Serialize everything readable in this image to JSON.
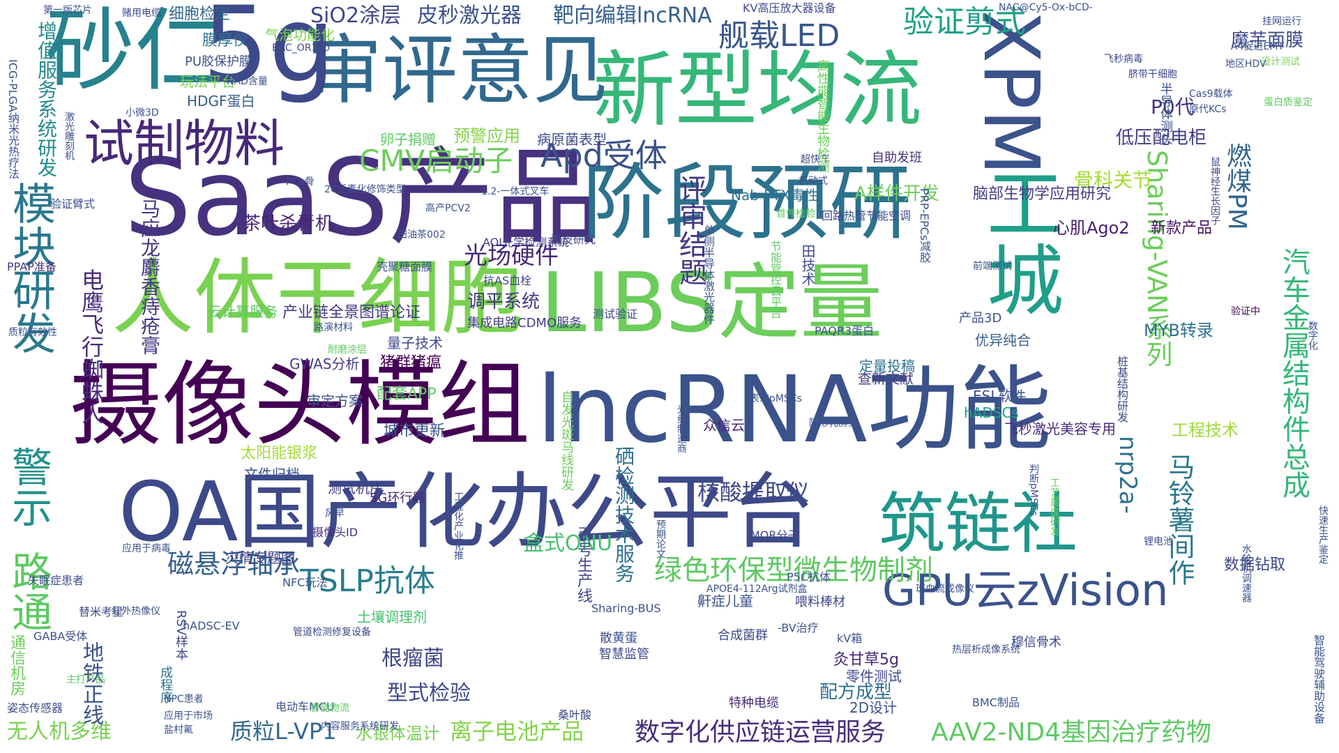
{
  "words": [
    {
      "text": "SaaS产品",
      "color": "#46327e"
    },
    {
      "text": "摄像头模组",
      "color": "#440154"
    },
    {
      "text": "lncRNA功能",
      "color": "#3b528b"
    },
    {
      "text": "OA国产化办公平台",
      "color": "#3e4989"
    },
    {
      "text": "人体干细胞",
      "color": "#7ad151"
    },
    {
      "text": "阶段预研",
      "color": "#2c728e"
    },
    {
      "text": "LIBS定量",
      "color": "#6ccd5a"
    },
    {
      "text": "新型均流",
      "color": "#35b779"
    },
    {
      "text": "审评意见",
      "color": "#31688e"
    },
    {
      "text": "砂仁",
      "color": "#26828e"
    },
    {
      "text": "5g",
      "color": "#3e4989"
    },
    {
      "text": "工城",
      "color": "#1f9e89"
    },
    {
      "text": "XPM",
      "color": "#3b528b"
    },
    {
      "text": "筑链社",
      "color": "#1f968b"
    },
    {
      "text": "试制物料",
      "color": "#482878"
    },
    {
      "text": "模块研发",
      "color": "#2a788e"
    },
    {
      "text": "路通",
      "color": "#5ec962"
    },
    {
      "text": "警示",
      "color": "#21918c"
    },
    {
      "text": "GPU云zVision",
      "color": "#3b528b"
    },
    {
      "text": "绿色环保型微生物制剂",
      "color": "#5ec962"
    },
    {
      "text": "CMV启动子",
      "color": "#6ccd5a"
    },
    {
      "text": "Apd受体",
      "color": "#3b528b"
    },
    {
      "text": "汽车金属结构件总成",
      "color": "#35b779"
    },
    {
      "text": "数字化供应链运营服务",
      "color": "#472d7b"
    },
    {
      "text": "AAV2-ND4基因治疗药物",
      "color": "#5ec962"
    },
    {
      "text": "磁悬浮轴承",
      "color": "#355f8d"
    },
    {
      "text": "TSLP抗体",
      "color": "#287c8e"
    },
    {
      "text": "验证剪式",
      "color": "#1fa188"
    },
    {
      "text": "舰载LED",
      "color": "#39568c"
    },
    {
      "text": "光场硬件",
      "color": "#482878"
    },
    {
      "text": "电鹰飞行蜘蛛人",
      "color": "#472d7b"
    },
    {
      "text": "评审结题",
      "color": "#443983"
    },
    {
      "text": "离子电池产品",
      "color": "#84d44b"
    },
    {
      "text": "马铃薯间作",
      "color": "#2a788e"
    },
    {
      "text": "Sharing-VAN系列",
      "color": "#6ccd5a"
    },
    {
      "text": "nrp2a-",
      "color": "#2c728e"
    },
    {
      "text": "核酸提取仪",
      "color": "#3e4989"
    },
    {
      "text": "质粒L-VP1",
      "color": "#31688e"
    },
    {
      "text": "无人机多维",
      "color": "#7ad151"
    },
    {
      "text": "骨科关节",
      "color": "#a5db36"
    },
    {
      "text": "燃煤PM",
      "color": "#32658e"
    },
    {
      "text": "增值服务系统研发",
      "color": "#23898e"
    },
    {
      "text": "SiO2涂层",
      "color": "#404688"
    },
    {
      "text": "皮秒激光器",
      "color": "#3b528b"
    },
    {
      "text": "靶向编辑lncRNA",
      "color": "#355f8d"
    },
    {
      "text": "茶叶杀青机",
      "color": "#482475"
    },
    {
      "text": "A样件开发",
      "color": "#6ccd5a"
    },
    {
      "text": "脑部生物学应用研究",
      "color": "#433e85"
    },
    {
      "text": "马应龙麝香痔疮膏",
      "color": "#453781"
    },
    {
      "text": "地铁正线",
      "color": "#3b528b"
    },
    {
      "text": "工程技术",
      "color": "#a0da39"
    },
    {
      "text": "水银体温计",
      "color": "#7ad151"
    },
    {
      "text": "根瘤菌",
      "color": "#404688"
    },
    {
      "text": "型式检验",
      "color": "#3e4989"
    },
    {
      "text": "硒检测技术服务",
      "color": "#2e6f8e"
    },
    {
      "text": "盒式ONU",
      "color": "#46c06f"
    },
    {
      "text": "调平系统",
      "color": "#443a83"
    },
    {
      "text": "产业链全景图谱论证",
      "color": "#443983"
    },
    {
      "text": "心肌Ago2",
      "color": "#481f70"
    },
    {
      "text": "新款产品",
      "color": "#481467"
    },
    {
      "text": "低压配电柜",
      "color": "#433e85"
    },
    {
      "text": "魔芋面膜",
      "color": "#3e4989"
    },
    {
      "text": "P0代",
      "color": "#46327e"
    },
    {
      "text": "MYB转录",
      "color": "#2c728e"
    },
    {
      "text": "飞秒激光美容专用",
      "color": "#472d7b"
    },
    {
      "text": "配方成型",
      "color": "#2e6f8e"
    },
    {
      "text": "数据钻取",
      "color": "#3e4989"
    },
    {
      "text": "卵子捐赠",
      "color": "#5ec962"
    },
    {
      "text": "预警应用",
      "color": "#84d44b"
    },
    {
      "text": "病原菌表型",
      "color": "#3e4989"
    },
    {
      "text": "细胞检定",
      "color": "#31688e"
    },
    {
      "text": "膜厚仪",
      "color": "#2c728e"
    },
    {
      "text": "气泡功能化",
      "color": "#7ad151"
    },
    {
      "text": "PU胶保护膜",
      "color": "#3b528b"
    },
    {
      "text": "玩法平台",
      "color": "#7ad151"
    },
    {
      "text": "HDGF蛋白",
      "color": "#355f8d"
    },
    {
      "text": "太阳能银浆",
      "color": "#a5db36"
    },
    {
      "text": "配套APP",
      "color": "#5ec962"
    },
    {
      "text": "猪群猪瘟",
      "color": "#440154"
    },
    {
      "text": "量子技术",
      "color": "#3e4989"
    },
    {
      "text": "审定方案",
      "color": "#3b528b"
    },
    {
      "text": "GWAS分析",
      "color": "#433e85"
    },
    {
      "text": "城市更新",
      "color": "#3b528b"
    },
    {
      "text": "文件归档",
      "color": "#3b528b"
    },
    {
      "text": "测试机房",
      "color": "#433e85"
    },
    {
      "text": "灾情专题图",
      "color": "#414487"
    },
    {
      "text": "云计算服务",
      "color": "#5ec962"
    },
    {
      "text": "集成电路CDMO服务",
      "color": "#433e85"
    },
    {
      "text": "优异纯合",
      "color": "#355f8d"
    },
    {
      "text": "ESL软件",
      "color": "#3b528b"
    },
    {
      "text": "hADSCs",
      "color": "#1f9e89"
    },
    {
      "text": "查新文献",
      "color": "#433e85"
    },
    {
      "text": "定量投稿",
      "color": "#2c728e"
    },
    {
      "text": "自助发班",
      "color": "#46327e"
    },
    {
      "text": "Nab-PTX毒性",
      "color": "#2e6f8e"
    },
    {
      "text": "田技术",
      "color": "#3e4989"
    },
    {
      "text": "引号生产线",
      "color": "#3e4989"
    },
    {
      "text": "众信云",
      "color": "#482878"
    },
    {
      "text": "通信机房",
      "color": "#6ccd5a"
    },
    {
      "text": "零件测试",
      "color": "#3e4989"
    },
    {
      "text": "2D设计",
      "color": "#3b528b"
    },
    {
      "text": "灸甘草5g",
      "color": "#482878"
    },
    {
      "text": "鼾症儿童",
      "color": "#3b528b"
    },
    {
      "text": "智慧监管",
      "color": "#3e4989"
    },
    {
      "text": "合成菌群",
      "color": "#3e4989"
    },
    {
      "text": "特种电缆",
      "color": "#482878"
    },
    {
      "text": "散黄蛋",
      "color": "#3b528b"
    },
    {
      "text": "喂料棒材",
      "color": "#3e4989"
    },
    {
      "text": "MOR分子",
      "color": "#3e4989"
    },
    {
      "text": "P5C抗体",
      "color": "#3b528b"
    },
    {
      "text": "5G环行器",
      "color": "#482878"
    },
    {
      "text": "成程序",
      "color": "#2c728e"
    },
    {
      "text": "RSV样本",
      "color": "#3e4989"
    },
    {
      "text": "GABA受体",
      "color": "#3b528b"
    },
    {
      "text": "姿态传感器",
      "color": "#3b528b"
    },
    {
      "text": "失眠症患者",
      "color": "#3b528b"
    },
    {
      "text": "替米考星",
      "color": "#3e4989"
    },
    {
      "text": "验证臂式",
      "color": "#3b528b"
    },
    {
      "text": "PPAP准备",
      "color": "#46327e"
    },
    {
      "text": "电动车MCU",
      "color": "#3b528b"
    },
    {
      "text": "摄像头ID",
      "color": "#46327e"
    },
    {
      "text": "土壤调理剂",
      "color": "#46c06f"
    },
    {
      "text": "AOI光学检测系统",
      "color": "#433e85"
    },
    {
      "text": "配皮研究",
      "color": "#3e4989"
    },
    {
      "text": "抗AS血栓",
      "color": "#3e4989"
    },
    {
      "text": "壳聚糖面膜",
      "color": "#3b528b"
    },
    {
      "text": "产品3D",
      "color": "#3b528b"
    },
    {
      "text": "PAQR3蛋白",
      "color": "#3b528b"
    },
    {
      "text": "测试验证",
      "color": "#3e4989"
    },
    {
      "text": "Sharing-BUS",
      "color": "#3b528b"
    },
    {
      "text": "桑叶酸",
      "color": "#3e4989"
    },
    {
      "text": "NFC玩法",
      "color": "#3b528b"
    },
    {
      "text": "单侧半导体激光器件",
      "color": "#3b528b"
    },
    {
      "text": "BMC制品",
      "color": "#3b528b"
    },
    {
      "text": "hADSC-EV",
      "color": "#3b528b"
    },
    {
      "text": "-BV治疗",
      "color": "#3b528b"
    },
    {
      "text": "kV箱",
      "color": "#3b528b"
    },
    {
      "text": "穆信骨术",
      "color": "#3e4989"
    },
    {
      "text": "风早",
      "color": "#3b528b"
    },
    {
      "text": "KV高压放大器设备",
      "color": "#3e4989"
    },
    {
      "text": "赌用电缆",
      "color": "#3e4989"
    },
    {
      "text": "挂网运行",
      "color": "#3b528b"
    },
    {
      "text": "设计测试",
      "color": "#7ad151"
    },
    {
      "text": "蛋白质鉴定",
      "color": "#5ec962"
    },
    {
      "text": "脐带干细胞",
      "color": "#3e4989"
    },
    {
      "text": "飞秒病毒",
      "color": "#3e4989"
    },
    {
      "text": "半导体测头",
      "color": "#3b528b"
    },
    {
      "text": "验证中",
      "color": "#440154"
    },
    {
      "text": "第一版芯片",
      "color": "#3b528b"
    },
    {
      "text": "NAD含量",
      "color": "#3b528b"
    },
    {
      "text": "小微3D",
      "color": "#3b528b"
    },
    {
      "text": "桩基结构研发",
      "color": "#3e4989"
    },
    {
      "text": "激光雕刻机",
      "color": "#3b528b"
    },
    {
      "text": "超快车",
      "color": "#3e4989"
    },
    {
      "text": "机动式",
      "color": "#3e4989"
    },
    {
      "text": "高性能智能生物检测",
      "color": "#6ccd5a"
    },
    {
      "text": "回路热管节能空调",
      "color": "#3e4989"
    },
    {
      "text": "PRP-EPCs减胶",
      "color": "#3b528b"
    },
    {
      "text": "前端测试",
      "color": "#3b528b"
    },
    {
      "text": "首件检验",
      "color": "#5ec962"
    },
    {
      "text": "ICG-PLGA纳米光热疗法",
      "color": "#3b528b"
    },
    {
      "text": "1.2-一体式叉车",
      "color": "#3b528b"
    },
    {
      "text": "高产PCV2",
      "color": "#3b528b"
    },
    {
      "text": "2C泛素化修饰类型",
      "color": "#3b528b"
    },
    {
      "text": "田油茶002",
      "color": "#3b528b"
    },
    {
      "text": "PCa骨",
      "color": "#3e4989"
    },
    {
      "text": "耐磨涂层",
      "color": "#5ec962"
    },
    {
      "text": "路演材料",
      "color": "#3b528b"
    },
    {
      "text": "应用于病毒",
      "color": "#3b528b"
    },
    {
      "text": "BAC_OR130",
      "color": "#3e4989"
    },
    {
      "text": "NAC@Cy5-Ox-bCD-",
      "color": "#3b528b"
    },
    {
      "text": "A4促进EMT",
      "color": "#3b528b"
    },
    {
      "text": "Cas9载体",
      "color": "#3b528b"
    },
    {
      "text": "原代KCs",
      "color": "#3b528b"
    },
    {
      "text": "地区HDV",
      "color": "#3b528b"
    },
    {
      "text": "鼠神经生长因子",
      "color": "#3e4989"
    },
    {
      "text": "水轮机调速器",
      "color": "#3b528b"
    },
    {
      "text": "智能驾驶辅助设备",
      "color": "#3b528b"
    },
    {
      "text": "主打产品",
      "color": "#5ec962"
    },
    {
      "text": "红外热像仪",
      "color": "#3b528b"
    },
    {
      "text": "管道检测修复设备",
      "color": "#3e4989"
    },
    {
      "text": "智能物流",
      "color": "#5ec962"
    },
    {
      "text": "内容服务系统研发",
      "color": "#3b528b"
    },
    {
      "text": "热层析成像系统",
      "color": "#3b528b"
    },
    {
      "text": "表达pMSCs",
      "color": "#3b528b"
    },
    {
      "text": "隐形乳房炎",
      "color": "#3b528b"
    },
    {
      "text": "工艺属度研发",
      "color": "#6ccd5a"
    },
    {
      "text": "判断pMSCs",
      "color": "#3b528b"
    },
    {
      "text": "斑血流成像仪",
      "color": "#3b528b"
    },
    {
      "text": "APOE4-112Arg试剂盒",
      "color": "#3b528b"
    },
    {
      "text": "光纤制造商",
      "color": "#3b528b"
    },
    {
      "text": "预期论文",
      "color": "#3b528b"
    },
    {
      "text": "质粒有效性",
      "color": "#3b528b"
    },
    {
      "text": "盐村氟",
      "color": "#3b528b"
    },
    {
      "text": "应用于市场",
      "color": "#3b528b"
    },
    {
      "text": "NPC患者",
      "color": "#3b528b"
    },
    {
      "text": "工程化产业化推",
      "color": "#3b528b"
    },
    {
      "text": "锂电池",
      "color": "#3b528b"
    },
    {
      "text": "自发光斑马线研发",
      "color": "#6ccd5a"
    },
    {
      "text": "数字化",
      "color": "#3b528b"
    },
    {
      "text": "节能管控云平台",
      "color": "#5ec962"
    },
    {
      "text": "快速生产鉴定",
      "color": "#3b528b"
    }
  ]
}
